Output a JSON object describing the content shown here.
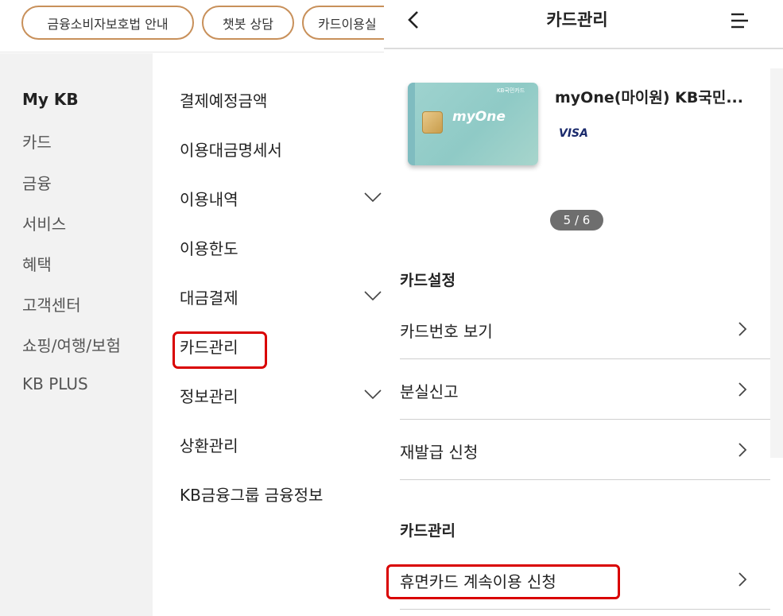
{
  "top_chips": [
    "금융소비자보호법 안내",
    "챗봇 상담",
    "카드이용실"
  ],
  "left_nav": {
    "items": [
      "My KB",
      "카드",
      "금융",
      "서비스",
      "혜택",
      "고객센터",
      "쇼핑/여행/보험",
      "KB PLUS"
    ],
    "active_index": 0
  },
  "sub_menu": {
    "items": [
      {
        "label": "결제예정금액",
        "expandable": false
      },
      {
        "label": "이용대금명세서",
        "expandable": false
      },
      {
        "label": "이용내역",
        "expandable": true
      },
      {
        "label": "이용한도",
        "expandable": false
      },
      {
        "label": "대금결제",
        "expandable": true
      },
      {
        "label": "카드관리",
        "expandable": false
      },
      {
        "label": "정보관리",
        "expandable": true
      },
      {
        "label": "상환관리",
        "expandable": false
      },
      {
        "label": "KB금융그룹 금융정보",
        "expandable": false
      }
    ],
    "highlighted_index": 5
  },
  "header": {
    "title": "카드관리",
    "back_icon": "chevron-left-icon",
    "menu_icon": "hamburger-menu-icon"
  },
  "card": {
    "name": "myOne(마이원) KB국민...",
    "network": "VISA",
    "card_logo_text": "myOne",
    "card_brand_mini": "KB국민카드",
    "color": "#9fd3cf"
  },
  "pager": "5 / 6",
  "sections": [
    {
      "title": "카드설정",
      "rows": [
        "카드번호 보기",
        "분실신고",
        "재발급 신청"
      ]
    },
    {
      "title": "카드관리",
      "rows": [
        "휴면카드 계속이용 신청"
      ]
    }
  ],
  "colors": {
    "chip_border": "#c8905a",
    "highlight": "#d90000",
    "nav_background": "#f2f2f2",
    "pager_background": "#6e6e6e"
  }
}
